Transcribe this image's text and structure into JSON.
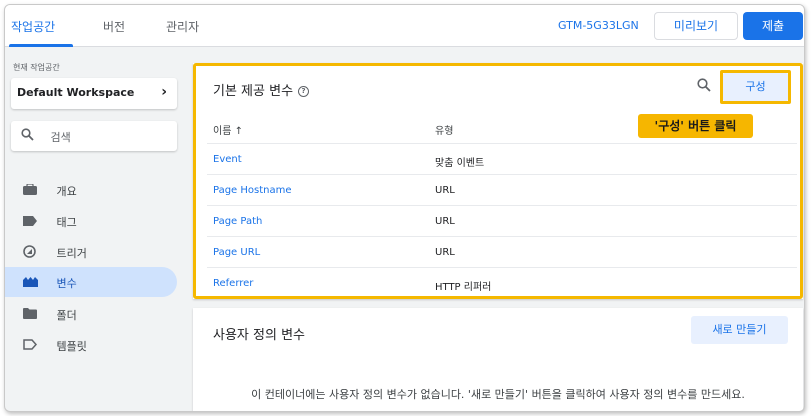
{
  "tabs": [
    {
      "label": "작업공간",
      "active": true
    },
    {
      "label": "버전",
      "active": false
    },
    {
      "label": "관리자",
      "active": false
    }
  ],
  "header": {
    "container_id": "GTM-5G33LGN",
    "preview_label": "미리보기",
    "submit_label": "제출"
  },
  "sidebar": {
    "workspace_label": "현재 작업공간",
    "workspace_name": "Default Workspace",
    "search_placeholder": "검색",
    "items": [
      {
        "label": "개요",
        "icon": "briefcase-icon",
        "active": false
      },
      {
        "label": "태그",
        "icon": "tag-icon",
        "active": false
      },
      {
        "label": "트리거",
        "icon": "trigger-icon",
        "active": false
      },
      {
        "label": "변수",
        "icon": "variable-icon",
        "active": true
      },
      {
        "label": "폴더",
        "icon": "folder-icon",
        "active": false
      },
      {
        "label": "템플릿",
        "icon": "template-icon",
        "active": false
      }
    ]
  },
  "builtin_panel": {
    "title": "기본 제공 변수",
    "configure_label": "구성",
    "callout": "'구성' 버튼 클릭",
    "col_name": "이름 ↑",
    "col_type": "유형",
    "rows": [
      {
        "name": "Event",
        "type": "맞춤 이벤트"
      },
      {
        "name": "Page Hostname",
        "type": "URL"
      },
      {
        "name": "Page Path",
        "type": "URL"
      },
      {
        "name": "Page URL",
        "type": "URL"
      },
      {
        "name": "Referrer",
        "type": "HTTP 리퍼러"
      }
    ]
  },
  "user_panel": {
    "title": "사용자 정의 변수",
    "new_label": "새로 만들기",
    "empty_message": "이 컨테이너에는 사용자 정의 변수가 없습니다. '새로 만들기' 버튼을 클릭하여 사용자 정의 변수를 만드세요."
  },
  "colors": {
    "accent": "#1a73e8",
    "highlight": "#f5b800"
  }
}
